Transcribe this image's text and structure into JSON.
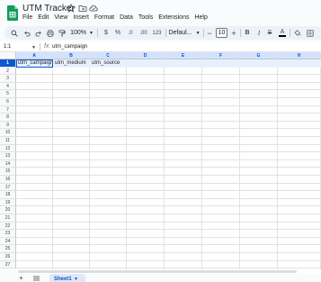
{
  "app": {
    "doc_title": "UTM Tracker",
    "menus": [
      "File",
      "Edit",
      "View",
      "Insert",
      "Format",
      "Data",
      "Tools",
      "Extensions",
      "Help"
    ]
  },
  "toolbar": {
    "zoom": "100%",
    "currency": "$",
    "percent": "%",
    "decrease_decimal": ".0",
    "increase_decimal": ".00",
    "number_format": "123",
    "font": "Defaul...",
    "font_size": "10",
    "minus": "−",
    "plus": "+",
    "bold": "B",
    "italic": "I",
    "strike": "S",
    "text_color": "A"
  },
  "formula_bar": {
    "name_box": "1:1",
    "fx": "fx",
    "value": "utm_campaign"
  },
  "grid": {
    "columns": [
      "A",
      "B",
      "C",
      "D",
      "E",
      "F",
      "G",
      "H"
    ],
    "rows": [
      "1",
      "2",
      "3",
      "4",
      "5",
      "6",
      "7",
      "8",
      "9",
      "10",
      "11",
      "12",
      "13",
      "14",
      "15",
      "16",
      "17",
      "18",
      "19",
      "20",
      "21",
      "22",
      "23",
      "24",
      "25",
      "26",
      "27"
    ],
    "row1_values": [
      "utm_campaign",
      "utm_medium",
      "utm_source"
    ],
    "selected_row": "1"
  },
  "sheets": {
    "add": "+",
    "tabs": [
      "Sheet1"
    ]
  },
  "colors": {
    "accent": "#0b57d0",
    "selection_fill": "#d3e3fd",
    "sheets_green": "#0f9d58"
  }
}
